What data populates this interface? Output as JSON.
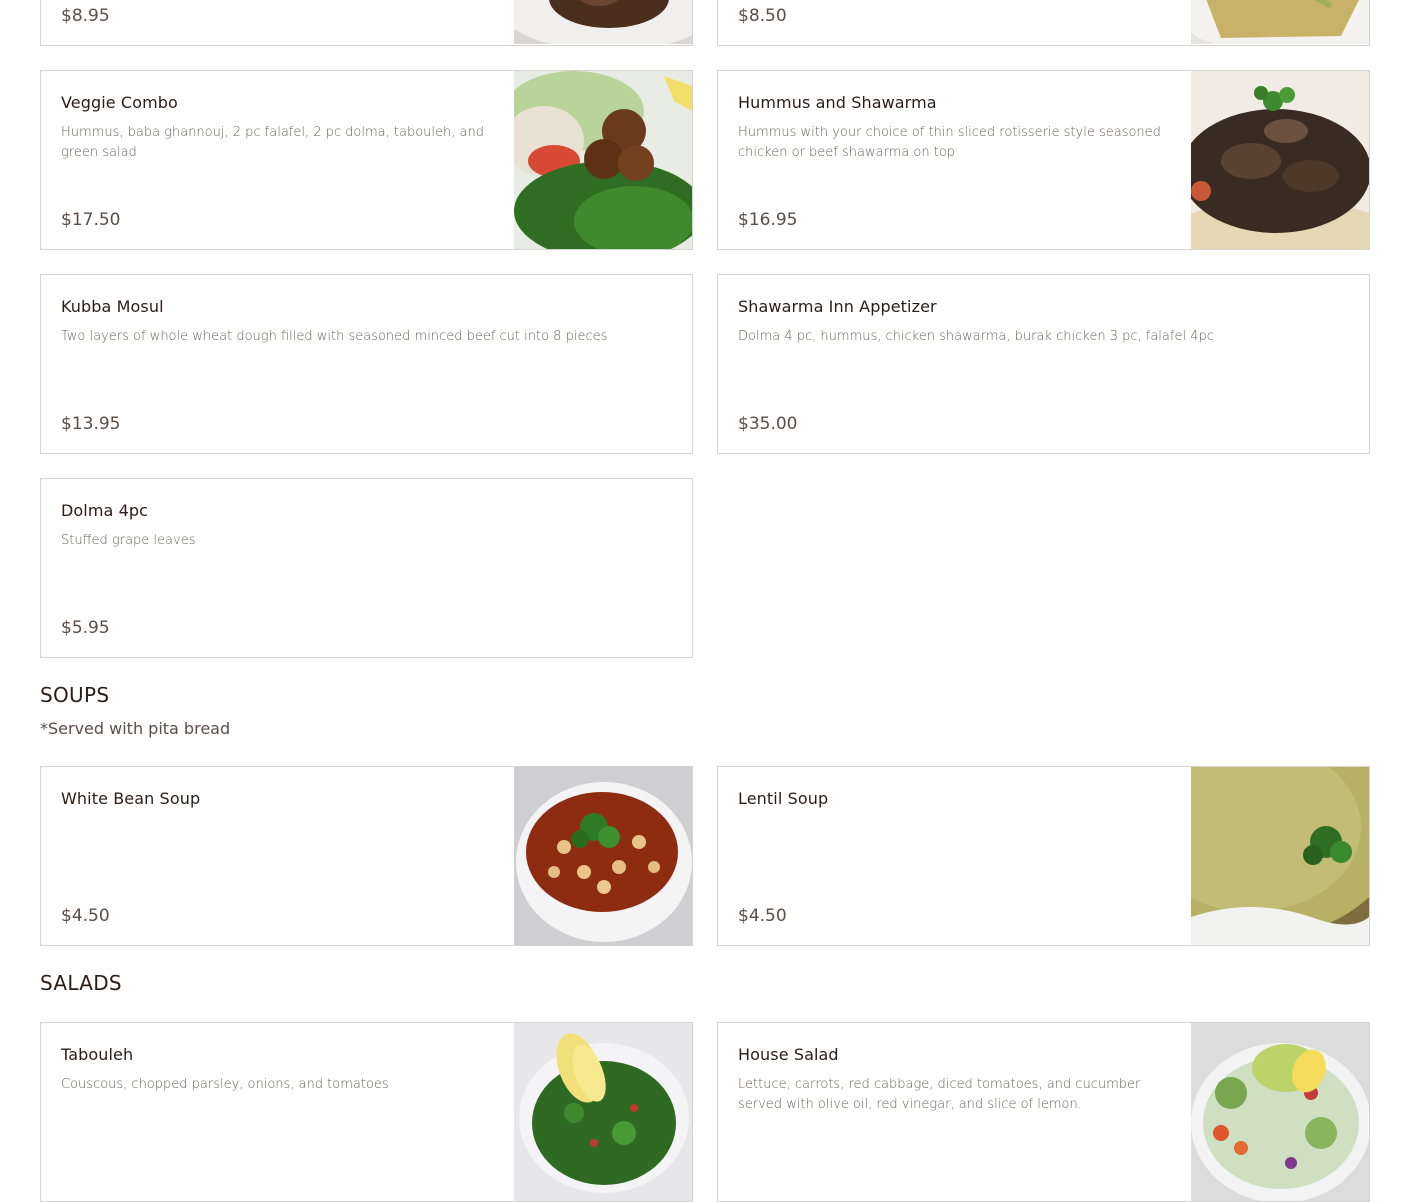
{
  "top_items": [
    {
      "price": "$8.95"
    },
    {
      "price": "$8.50"
    }
  ],
  "appetizers": [
    {
      "name": "Veggie Combo",
      "description": "Hummus, baba ghannouj, 2 pc falafel, 2 pc dolma, tabouleh, and green salad",
      "price": "$17.50",
      "image": "falafel-plate-photo"
    },
    {
      "name": "Hummus and Shawarma",
      "description": "Hummus with your choice of thin sliced rotisserie style seasoned chicken or beef shawarma on top",
      "price": "$16.95",
      "image": "hummus-shawarma-photo"
    },
    {
      "name": "Kubba Mosul",
      "description": "Two layers of whole wheat dough filled with seasoned minced beef cut into 8 pieces",
      "price": "$13.95"
    },
    {
      "name": "Shawarma Inn Appetizer",
      "description": "Dolma 4 pc, hummus, chicken shawarma, burak chicken 3 pc, falafel 4pc",
      "price": "$35.00"
    },
    {
      "name": "Dolma 4pc",
      "description": "Stuffed grape leaves",
      "price": "$5.95"
    }
  ],
  "soups": {
    "title": "SOUPS",
    "note": "*Served with pita bread",
    "items": [
      {
        "name": "White Bean Soup",
        "price": "$4.50",
        "image": "bean-soup-photo"
      },
      {
        "name": "Lentil Soup",
        "price": "$4.50",
        "image": "lentil-soup-photo"
      }
    ]
  },
  "salads": {
    "title": "SALADS",
    "items": [
      {
        "name": "Tabouleh",
        "description": "Couscous, chopped parsley, onions, and tomatoes",
        "image": "tabouleh-photo"
      },
      {
        "name": "House Salad",
        "description": "Lettuce, carrots, red cabbage, diced tomatoes, and cucumber served with olive oil, red vinegar, and slice of lemon.",
        "image": "house-salad-photo"
      }
    ]
  }
}
